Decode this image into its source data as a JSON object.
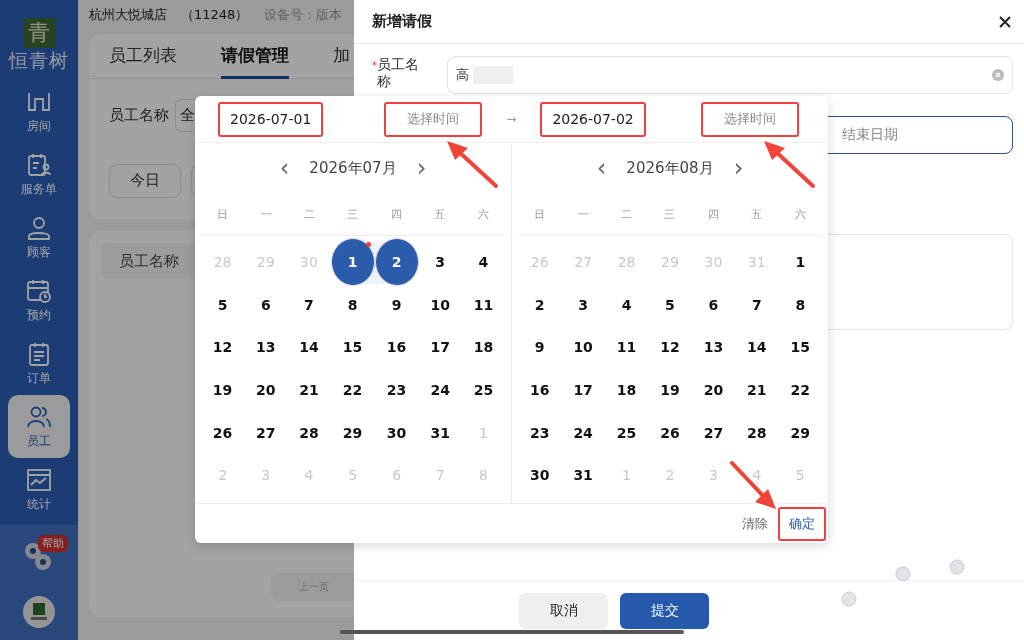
{
  "sidebar": {
    "logo_mark": "青",
    "brand": "恒青树",
    "items": [
      {
        "label": "房间",
        "kind": "room",
        "selected": false
      },
      {
        "label": "服务单",
        "kind": "service",
        "selected": false
      },
      {
        "label": "顾客",
        "kind": "customer",
        "selected": false
      },
      {
        "label": "预约",
        "kind": "booking",
        "selected": false
      },
      {
        "label": "订单",
        "kind": "order",
        "selected": false
      },
      {
        "label": "员工",
        "kind": "staff",
        "selected": true
      },
      {
        "label": "统计",
        "kind": "stats",
        "selected": false
      }
    ],
    "help_badge": "帮助"
  },
  "header": {
    "store": "杭州大悦城店",
    "code": "（11248）",
    "device": "设备号：版本"
  },
  "tabs": [
    {
      "label": "员工列表",
      "selected": false
    },
    {
      "label": "请假管理",
      "selected": true
    },
    {
      "label": "加",
      "selected": false
    }
  ],
  "filter": {
    "label": "员工名称",
    "value": "全"
  },
  "quick_buttons": [
    "今日"
  ],
  "table": {
    "columns": [
      "员工名称"
    ]
  },
  "pager": {
    "prev": "上一页"
  },
  "drawer": {
    "title": "新增请假",
    "fields": [
      {
        "kind": "text",
        "required_mark": "*",
        "label": "员工名称",
        "value": "高"
      },
      {
        "kind": "daterange",
        "placeholder": "结束日期"
      },
      {
        "kind": "textarea"
      }
    ],
    "buttons": [
      {
        "label": "取消",
        "kind": "secondary"
      },
      {
        "label": "提交",
        "kind": "primary"
      }
    ]
  },
  "picker": {
    "start": {
      "date": "2026-07-01",
      "date_highlighted": true,
      "time_placeholder": "选择时间",
      "time_highlighted": true
    },
    "separator": "→",
    "end": {
      "date": "2026-07-02",
      "date_highlighted": true,
      "time_placeholder": "选择时间",
      "time_highlighted": true
    },
    "calendars": [
      {
        "title": "2026年07月",
        "prev": "‹",
        "next": "›",
        "weekdays": [
          "日",
          "一",
          "二",
          "三",
          "四",
          "五",
          "六"
        ],
        "weeks": [
          [
            {
              "d": "28",
              "muted": true,
              "selected": false,
              "today": false
            },
            {
              "d": "29",
              "muted": true,
              "selected": false,
              "today": false
            },
            {
              "d": "30",
              "muted": true,
              "selected": false,
              "today": false
            },
            {
              "d": "1",
              "muted": false,
              "selected": true,
              "today": true
            },
            {
              "d": "2",
              "muted": false,
              "selected": true,
              "today": false
            },
            {
              "d": "3",
              "muted": false,
              "selected": false,
              "today": false
            },
            {
              "d": "4",
              "muted": false,
              "selected": false,
              "today": false
            }
          ],
          [
            {
              "d": "5",
              "muted": false,
              "selected": false,
              "today": false
            },
            {
              "d": "6",
              "muted": false,
              "selected": false,
              "today": false
            },
            {
              "d": "7",
              "muted": false,
              "selected": false,
              "today": false
            },
            {
              "d": "8",
              "muted": false,
              "selected": false,
              "today": false
            },
            {
              "d": "9",
              "muted": false,
              "selected": false,
              "today": false
            },
            {
              "d": "10",
              "muted": false,
              "selected": false,
              "today": false
            },
            {
              "d": "11",
              "muted": false,
              "selected": false,
              "today": false
            }
          ],
          [
            {
              "d": "12",
              "muted": false,
              "selected": false,
              "today": false
            },
            {
              "d": "13",
              "muted": false,
              "selected": false,
              "today": false
            },
            {
              "d": "14",
              "muted": false,
              "selected": false,
              "today": false
            },
            {
              "d": "15",
              "muted": false,
              "selected": false,
              "today": false
            },
            {
              "d": "16",
              "muted": false,
              "selected": false,
              "today": false
            },
            {
              "d": "17",
              "muted": false,
              "selected": false,
              "today": false
            },
            {
              "d": "18",
              "muted": false,
              "selected": false,
              "today": false
            }
          ],
          [
            {
              "d": "19",
              "muted": false,
              "selected": false,
              "today": false
            },
            {
              "d": "20",
              "muted": false,
              "selected": false,
              "today": false
            },
            {
              "d": "21",
              "muted": false,
              "selected": false,
              "today": false
            },
            {
              "d": "22",
              "muted": false,
              "selected": false,
              "today": false
            },
            {
              "d": "23",
              "muted": false,
              "selected": false,
              "today": false
            },
            {
              "d": "24",
              "muted": false,
              "selected": false,
              "today": false
            },
            {
              "d": "25",
              "muted": false,
              "selected": false,
              "today": false
            }
          ],
          [
            {
              "d": "26",
              "muted": false,
              "selected": false,
              "today": false
            },
            {
              "d": "27",
              "muted": false,
              "selected": false,
              "today": false
            },
            {
              "d": "28",
              "muted": false,
              "selected": false,
              "today": false
            },
            {
              "d": "29",
              "muted": false,
              "selected": false,
              "today": false
            },
            {
              "d": "30",
              "muted": false,
              "selected": false,
              "today": false
            },
            {
              "d": "31",
              "muted": false,
              "selected": false,
              "today": false
            },
            {
              "d": "1",
              "muted": true,
              "selected": false,
              "today": false
            }
          ],
          [
            {
              "d": "2",
              "muted": true,
              "selected": false,
              "today": false
            },
            {
              "d": "3",
              "muted": true,
              "selected": false,
              "today": false
            },
            {
              "d": "4",
              "muted": true,
              "selected": false,
              "today": false
            },
            {
              "d": "5",
              "muted": true,
              "selected": false,
              "today": false
            },
            {
              "d": "6",
              "muted": true,
              "selected": false,
              "today": false
            },
            {
              "d": "7",
              "muted": true,
              "selected": false,
              "today": false
            },
            {
              "d": "8",
              "muted": true,
              "selected": false,
              "today": false
            }
          ]
        ]
      },
      {
        "title": "2026年08月",
        "prev": "‹",
        "next": "›",
        "weekdays": [
          "日",
          "一",
          "二",
          "三",
          "四",
          "五",
          "六"
        ],
        "weeks": [
          [
            {
              "d": "26",
              "muted": true,
              "selected": false,
              "today": false
            },
            {
              "d": "27",
              "muted": true,
              "selected": false,
              "today": false
            },
            {
              "d": "28",
              "muted": true,
              "selected": false,
              "today": false
            },
            {
              "d": "29",
              "muted": true,
              "selected": false,
              "today": false
            },
            {
              "d": "30",
              "muted": true,
              "selected": false,
              "today": false
            },
            {
              "d": "31",
              "muted": true,
              "selected": false,
              "today": false
            },
            {
              "d": "1",
              "muted": false,
              "selected": false,
              "today": false
            }
          ],
          [
            {
              "d": "2",
              "muted": false,
              "selected": false,
              "today": false
            },
            {
              "d": "3",
              "muted": false,
              "selected": false,
              "today": false
            },
            {
              "d": "4",
              "muted": false,
              "selected": false,
              "today": false
            },
            {
              "d": "5",
              "muted": false,
              "selected": false,
              "today": false
            },
            {
              "d": "6",
              "muted": false,
              "selected": false,
              "today": false
            },
            {
              "d": "7",
              "muted": false,
              "selected": false,
              "today": false
            },
            {
              "d": "8",
              "muted": false,
              "selected": false,
              "today": false
            }
          ],
          [
            {
              "d": "9",
              "muted": false,
              "selected": false,
              "today": false
            },
            {
              "d": "10",
              "muted": false,
              "selected": false,
              "today": false
            },
            {
              "d": "11",
              "muted": false,
              "selected": false,
              "today": false
            },
            {
              "d": "12",
              "muted": false,
              "selected": false,
              "today": false
            },
            {
              "d": "13",
              "muted": false,
              "selected": false,
              "today": false
            },
            {
              "d": "14",
              "muted": false,
              "selected": false,
              "today": false
            },
            {
              "d": "15",
              "muted": false,
              "selected": false,
              "today": false
            }
          ],
          [
            {
              "d": "16",
              "muted": false,
              "selected": false,
              "today": false
            },
            {
              "d": "17",
              "muted": false,
              "selected": false,
              "today": false
            },
            {
              "d": "18",
              "muted": false,
              "selected": false,
              "today": false
            },
            {
              "d": "19",
              "muted": false,
              "selected": false,
              "today": false
            },
            {
              "d": "20",
              "muted": false,
              "selected": false,
              "today": false
            },
            {
              "d": "21",
              "muted": false,
              "selected": false,
              "today": false
            },
            {
              "d": "22",
              "muted": false,
              "selected": false,
              "today": false
            }
          ],
          [
            {
              "d": "23",
              "muted": false,
              "selected": false,
              "today": false
            },
            {
              "d": "24",
              "muted": false,
              "selected": false,
              "today": false
            },
            {
              "d": "25",
              "muted": false,
              "selected": false,
              "today": false
            },
            {
              "d": "26",
              "muted": false,
              "selected": false,
              "today": false
            },
            {
              "d": "27",
              "muted": false,
              "selected": false,
              "today": false
            },
            {
              "d": "28",
              "muted": false,
              "selected": false,
              "today": false
            },
            {
              "d": "29",
              "muted": false,
              "selected": false,
              "today": false
            }
          ],
          [
            {
              "d": "30",
              "muted": false,
              "selected": false,
              "today": false
            },
            {
              "d": "31",
              "muted": false,
              "selected": false,
              "today": false
            },
            {
              "d": "1",
              "muted": true,
              "selected": false,
              "today": false
            },
            {
              "d": "2",
              "muted": true,
              "selected": false,
              "today": false
            },
            {
              "d": "3",
              "muted": true,
              "selected": false,
              "today": false
            },
            {
              "d": "4",
              "muted": true,
              "selected": false,
              "today": false
            },
            {
              "d": "5",
              "muted": true,
              "selected": false,
              "today": false
            }
          ]
        ]
      }
    ],
    "footer": [
      {
        "label": "清除",
        "kind": "clear",
        "highlighted": false
      },
      {
        "label": "确定",
        "kind": "confirm",
        "highlighted": true
      }
    ]
  }
}
